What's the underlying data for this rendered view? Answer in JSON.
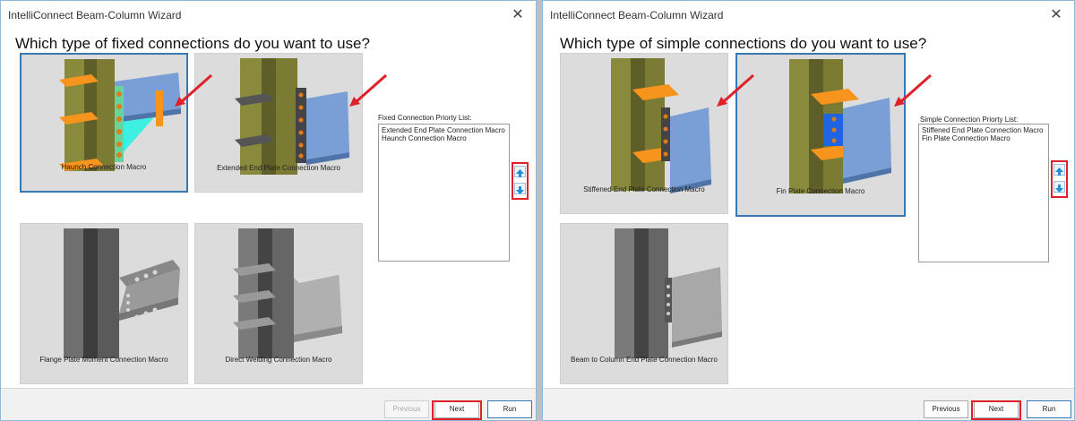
{
  "left": {
    "window_title": "IntelliConnect Beam-Column Wizard",
    "close_glyph": "✕",
    "question": "Which type of fixed connections do you want to use?",
    "tiles": [
      {
        "caption": "Haunch Connection Macro"
      },
      {
        "caption": "Extended End Plate Connection Macro"
      },
      {
        "caption": "Flange Plate Moment Connection Macro"
      },
      {
        "caption": "Direct Welding Connection Macro"
      }
    ],
    "priority_label": "Fixed Connection Priorty List:",
    "priority_items": [
      "Extended End Plate Connection Macro",
      "Haunch Connection Macro"
    ],
    "buttons": {
      "previous": "Previous",
      "next": "Next",
      "run": "Run"
    }
  },
  "right": {
    "window_title": "IntelliConnect Beam-Column Wizard",
    "close_glyph": "✕",
    "question": "Which type of simple connections do you want to use?",
    "tiles": [
      {
        "caption": "Stiffened End Plate Connection Macro"
      },
      {
        "caption": "Fin Plate Connection Macro"
      },
      {
        "caption": "Beam to Column End Plate Connection Macro"
      }
    ],
    "priority_label": "Simple Connection Priorty List:",
    "priority_items": [
      "Stiffened End Plate Connection Macro",
      "Fin Plate Connection Macro"
    ],
    "buttons": {
      "previous": "Previous",
      "next": "Next",
      "run": "Run"
    }
  },
  "icons": {
    "move_up": "arrow-up-icon",
    "move_down": "arrow-down-icon"
  },
  "colors": {
    "selection_border": "#3a78b5",
    "highlight_red": "#e0202a",
    "steel_blue": "#7a9fd6",
    "orange": "#f7941d",
    "olive": "#8a8a3c"
  }
}
